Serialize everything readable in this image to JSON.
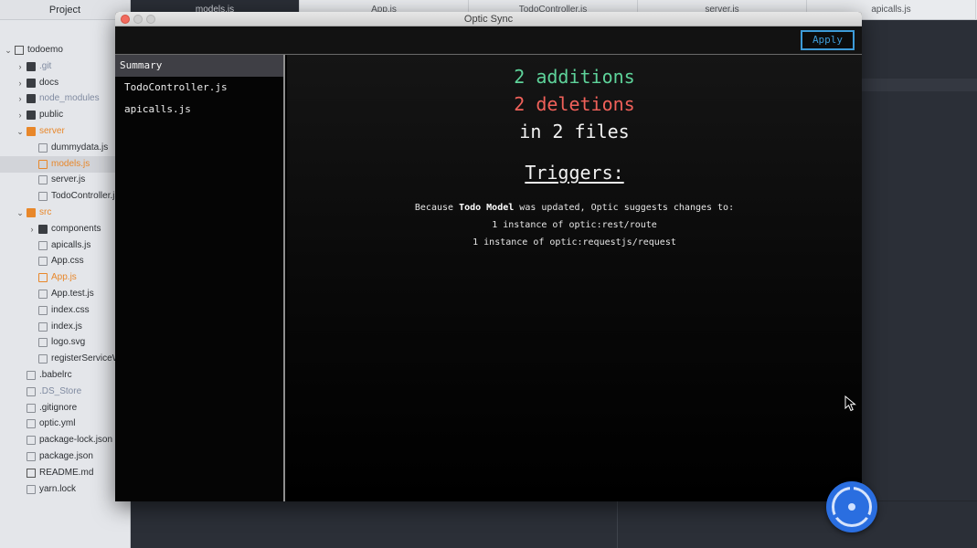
{
  "tree": {
    "title": "Project",
    "items": [
      {
        "label": "todoemo",
        "depth": 0,
        "kind": "repo",
        "arrow": "⌄"
      },
      {
        "label": ".git",
        "depth": 1,
        "kind": "folder",
        "arrow": "›",
        "muted": true
      },
      {
        "label": "docs",
        "depth": 1,
        "kind": "folder",
        "arrow": "›"
      },
      {
        "label": "node_modules",
        "depth": 1,
        "kind": "folder",
        "arrow": "›",
        "muted": true
      },
      {
        "label": "public",
        "depth": 1,
        "kind": "folder",
        "arrow": "›"
      },
      {
        "label": "server",
        "depth": 1,
        "kind": "folder-orange",
        "arrow": "⌄",
        "orange": true
      },
      {
        "label": "dummydata.js",
        "depth": 2,
        "kind": "file"
      },
      {
        "label": "models.js",
        "depth": 2,
        "kind": "file-orange",
        "orange": true,
        "selected": true
      },
      {
        "label": "server.js",
        "depth": 2,
        "kind": "file"
      },
      {
        "label": "TodoController.js",
        "depth": 2,
        "kind": "file"
      },
      {
        "label": "src",
        "depth": 1,
        "kind": "folder-orange",
        "arrow": "⌄",
        "orange": true
      },
      {
        "label": "components",
        "depth": 2,
        "kind": "folder",
        "arrow": "›"
      },
      {
        "label": "apicalls.js",
        "depth": 2,
        "kind": "file"
      },
      {
        "label": "App.css",
        "depth": 2,
        "kind": "file"
      },
      {
        "label": "App.js",
        "depth": 2,
        "kind": "file-orange",
        "orange": true
      },
      {
        "label": "App.test.js",
        "depth": 2,
        "kind": "file"
      },
      {
        "label": "index.css",
        "depth": 2,
        "kind": "file"
      },
      {
        "label": "index.js",
        "depth": 2,
        "kind": "file"
      },
      {
        "label": "logo.svg",
        "depth": 2,
        "kind": "file"
      },
      {
        "label": "registerServiceW",
        "depth": 2,
        "kind": "file"
      },
      {
        "label": ".babelrc",
        "depth": 1,
        "kind": "file"
      },
      {
        "label": ".DS_Store",
        "depth": 1,
        "kind": "file",
        "muted": true
      },
      {
        "label": ".gitignore",
        "depth": 1,
        "kind": "file"
      },
      {
        "label": "optic.yml",
        "depth": 1,
        "kind": "file"
      },
      {
        "label": "package-lock.json",
        "depth": 1,
        "kind": "file"
      },
      {
        "label": "package.json",
        "depth": 1,
        "kind": "file"
      },
      {
        "label": "README.md",
        "depth": 1,
        "kind": "readme"
      },
      {
        "label": "yarn.lock",
        "depth": 1,
        "kind": "file"
      }
    ]
  },
  "tabs": [
    {
      "label": "models.js",
      "active": true
    },
    {
      "label": "App.js"
    },
    {
      "label": "TodoController.js"
    },
    {
      "label": "server.js"
    },
    {
      "label": "apicalls.js"
    }
  ],
  "optic": {
    "window_title": "Optic Sync",
    "apply_label": "Apply",
    "sidebar": [
      "Summary",
      "TodoController.js",
      "apicalls.js"
    ],
    "additions": "2 additions",
    "deletions": "2 deletions",
    "files": "in 2 files",
    "triggers_title": "Triggers:",
    "because_pre": "Because ",
    "model_name": "Todo Model",
    "because_post": " was updated, Optic suggests changes to:",
    "suggestions": [
      "1 instance of optic:rest/route",
      "1 instance of optic:requestjs/request"
    ]
  },
  "colors": {
    "additions": "#5ed39a",
    "deletions": "#f0615a",
    "apply_accent": "#3d9bd8",
    "widget": "#2a6ee0"
  }
}
